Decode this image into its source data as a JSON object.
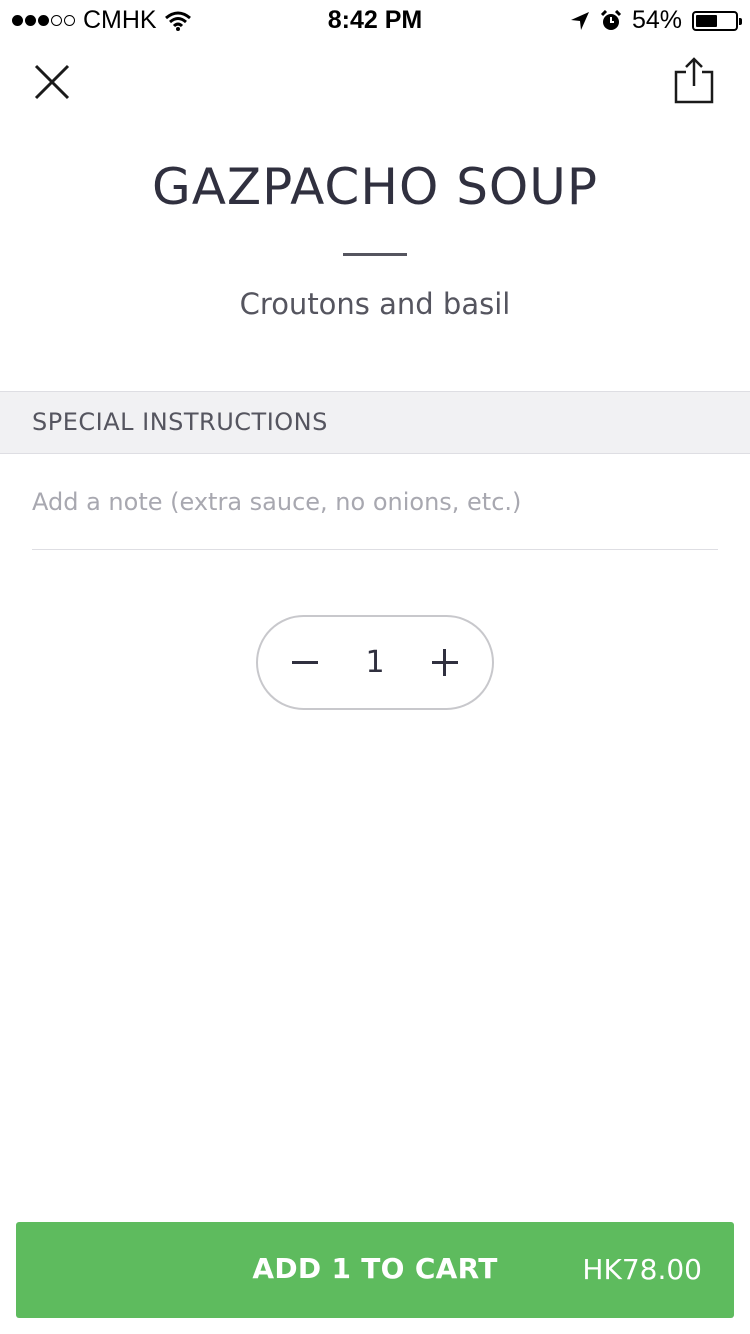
{
  "status_bar": {
    "carrier": "CMHK",
    "time": "8:42 PM",
    "battery_percent": "54%",
    "battery_level": 0.54
  },
  "header": {
    "close_icon": "close-icon",
    "share_icon": "share-icon"
  },
  "item": {
    "title": "GAZPACHO SOUP",
    "description": "Croutons and basil"
  },
  "special_instructions": {
    "header": "SPECIAL INSTRUCTIONS",
    "placeholder": "Add a note (extra sauce, no onions, etc.)",
    "value": ""
  },
  "quantity": {
    "value": "1"
  },
  "cart_button": {
    "label": "ADD 1 TO CART",
    "price": "HK78.00",
    "color": "#5ebb5e"
  }
}
